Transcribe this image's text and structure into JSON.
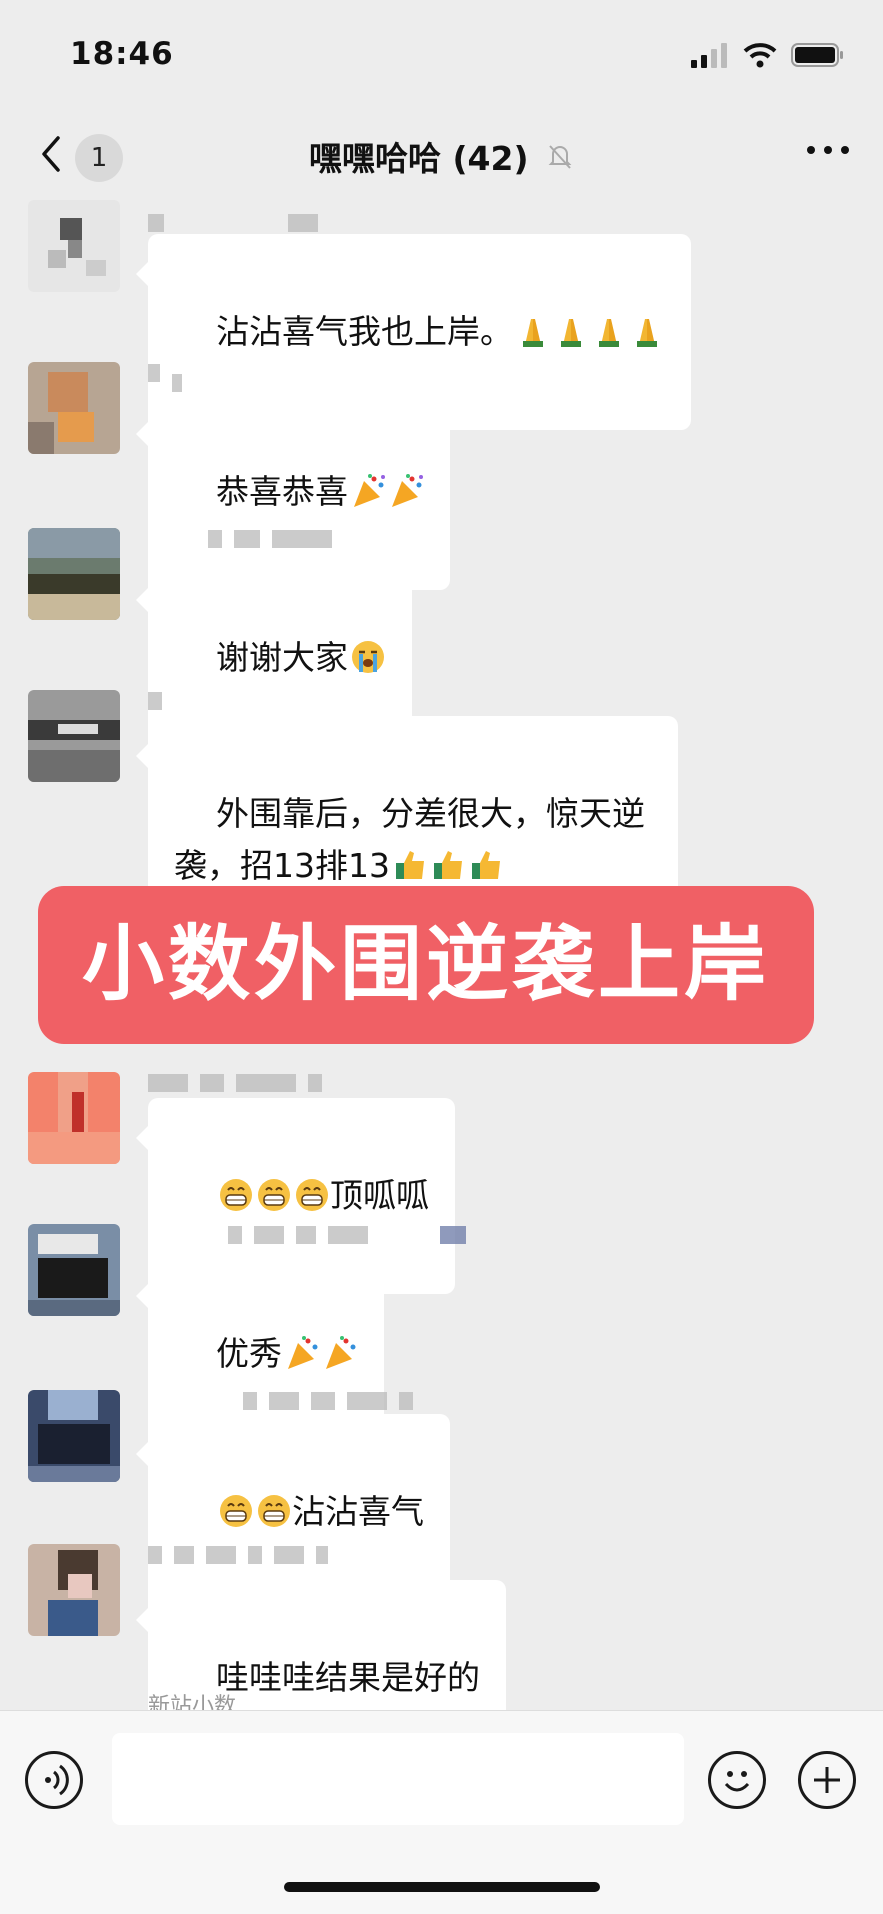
{
  "status": {
    "time": "18:46"
  },
  "nav": {
    "unread": "1",
    "title": "嘿嘿哈哈 (42)"
  },
  "messages": [
    {
      "text": "沾沾喜气我也上岸。",
      "emoji": [
        "folded-hands",
        "folded-hands",
        "folded-hands",
        "folded-hands"
      ],
      "emoji_position": "after"
    },
    {
      "text": "恭喜恭喜",
      "emoji": [
        "party-popper",
        "party-popper"
      ],
      "emoji_position": "after"
    },
    {
      "text": "谢谢大家",
      "emoji": [
        "crying-face"
      ],
      "emoji_position": "after"
    },
    {
      "text": "外围靠后，分差很大，惊天逆袭，招13排13",
      "emoji": [
        "thumbs-up",
        "thumbs-up",
        "thumbs-up"
      ],
      "emoji_position": "after"
    },
    {
      "text": "顶呱呱",
      "emoji": [
        "grinning-face",
        "grinning-face",
        "grinning-face"
      ],
      "emoji_position": "before"
    },
    {
      "text": "优秀",
      "emoji": [
        "party-popper",
        "party-popper"
      ],
      "emoji_position": "after"
    },
    {
      "text": "沾沾喜气",
      "emoji": [
        "grinning-face",
        "grinning-face"
      ],
      "emoji_position": "before"
    },
    {
      "text": "哇哇哇结果是好的",
      "emoji": [],
      "emoji_position": "after"
    }
  ],
  "banner": {
    "text": "小数外围逆袭上岸"
  },
  "faded_sender": "新站小数",
  "colors": {
    "background": "#ededed",
    "bubble": "#ffffff",
    "banner": "#f06065"
  }
}
